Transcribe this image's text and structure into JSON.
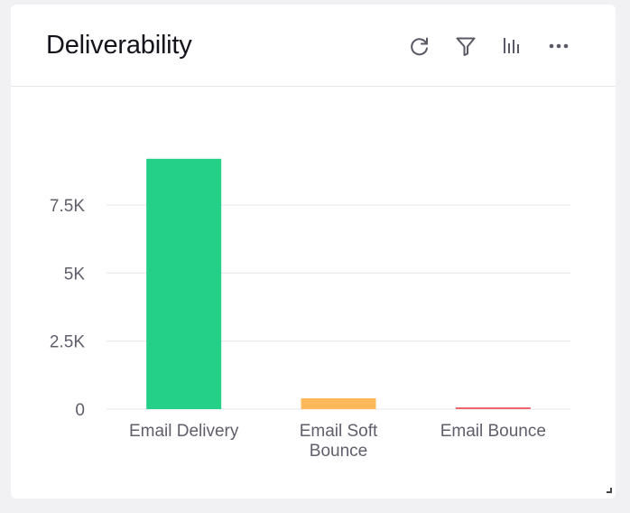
{
  "widget": {
    "title": "Deliverability",
    "toolbar": [
      {
        "name": "refresh-icon",
        "label": "Refresh"
      },
      {
        "name": "filter-icon",
        "label": "Filter"
      },
      {
        "name": "chart-type-icon",
        "label": "Chart type"
      },
      {
        "name": "more-options-icon",
        "label": "More options"
      }
    ]
  },
  "chart_data": {
    "type": "bar",
    "title": "Deliverability",
    "xlabel": "",
    "ylabel": "",
    "categories": [
      "Email Delivery",
      "Email Soft Bounce",
      "Email Bounce"
    ],
    "category_label_lines": [
      [
        "Email Delivery"
      ],
      [
        "Email Soft",
        "Bounce"
      ],
      [
        "Email Bounce"
      ]
    ],
    "values": [
      9200,
      400,
      50
    ],
    "colors": [
      "#24d087",
      "#ffb95a",
      "#f0646c"
    ],
    "ylim": [
      0,
      10000
    ],
    "yticks": [
      0,
      2500,
      5000,
      7500
    ],
    "ytick_labels": [
      "0",
      "2.5K",
      "5K",
      "7.5K"
    ],
    "grid": true,
    "legend": "none"
  }
}
